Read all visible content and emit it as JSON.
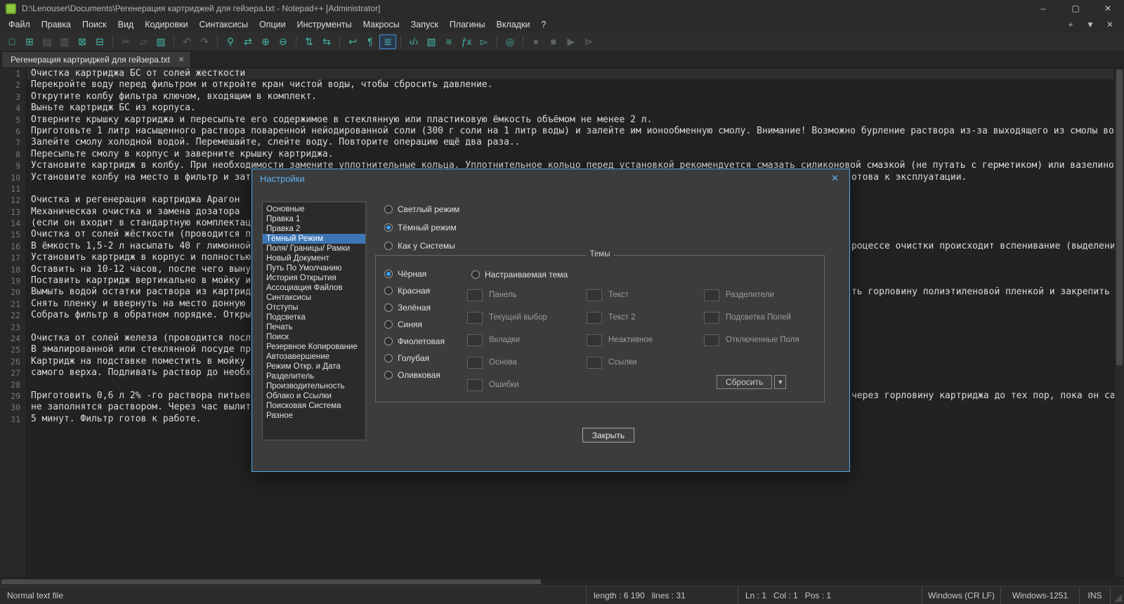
{
  "glyphs": {
    "close": "✕",
    "dropdown": "▼"
  },
  "colors": {
    "accent": "#51a7e8",
    "selection": "#3d76b5",
    "toolbar_icon": "#45b8a8",
    "radio_dot": "#35a2ff"
  },
  "window": {
    "title": "D:\\Lenouser\\Documents\\Регенерация картриджей для гейзера.txt - Notepad++ [Administrator]",
    "controls": [
      {
        "name": "minimize",
        "glyph": "–"
      },
      {
        "name": "maximize",
        "glyph": "▢"
      },
      {
        "name": "close",
        "glyph": "✕"
      }
    ]
  },
  "menubar": {
    "items": [
      "Файл",
      "Правка",
      "Поиск",
      "Вид",
      "Кодировки",
      "Синтаксисы",
      "Опции",
      "Инструменты",
      "Макросы",
      "Запуск",
      "Плагины",
      "Вкладки",
      "?"
    ],
    "extra_icons": [
      {
        "name": "new-tab",
        "glyph": "+"
      },
      {
        "name": "tab-list",
        "glyph": "▼"
      },
      {
        "name": "close-tab",
        "glyph": "✕"
      }
    ]
  },
  "toolbar": {
    "items": [
      {
        "name": "new-file",
        "glyph": "□"
      },
      {
        "name": "open-file",
        "glyph": "⊞"
      },
      {
        "name": "save-file",
        "glyph": "▤",
        "state": "disabled"
      },
      {
        "name": "save-all",
        "glyph": "▥",
        "state": "disabled"
      },
      {
        "name": "close-file",
        "glyph": "⊠"
      },
      {
        "name": "close-all",
        "glyph": "⊟"
      },
      {
        "sep": true
      },
      {
        "name": "cut",
        "glyph": "✂",
        "state": "disabled"
      },
      {
        "name": "copy",
        "glyph": "▱",
        "state": "disabled"
      },
      {
        "name": "paste",
        "glyph": "▨"
      },
      {
        "sep": true
      },
      {
        "name": "undo",
        "glyph": "↶",
        "state": "disabled"
      },
      {
        "name": "redo",
        "glyph": "↷",
        "state": "disabled"
      },
      {
        "sep": true
      },
      {
        "name": "find",
        "glyph": "⚲"
      },
      {
        "name": "replace",
        "glyph": "⇄"
      },
      {
        "name": "zoom-in",
        "glyph": "⊕"
      },
      {
        "name": "zoom-out",
        "glyph": "⊖"
      },
      {
        "sep": true
      },
      {
        "name": "sync-vertical",
        "glyph": "⇅"
      },
      {
        "name": "sync-horizontal",
        "glyph": "⇆"
      },
      {
        "sep": true
      },
      {
        "name": "word-wrap",
        "glyph": "↩"
      },
      {
        "name": "show-all-characters",
        "glyph": "¶"
      },
      {
        "name": "indent-guide",
        "glyph": "≣",
        "state": "active"
      },
      {
        "sep": true
      },
      {
        "name": "user-define-language",
        "glyph": "‹/›"
      },
      {
        "name": "document-map",
        "glyph": "▧"
      },
      {
        "name": "document-list",
        "glyph": "≡"
      },
      {
        "name": "function-list",
        "glyph": "ƒx"
      },
      {
        "name": "folder-as-workspace",
        "glyph": "▻"
      },
      {
        "sep": true
      },
      {
        "name": "monitoring",
        "glyph": "◎"
      },
      {
        "sep": true
      },
      {
        "name": "macro-record",
        "glyph": "●",
        "state": "disabled"
      },
      {
        "name": "macro-stop",
        "glyph": "■",
        "state": "disabled"
      },
      {
        "name": "macro-play",
        "glyph": "▶",
        "state": "disabled"
      },
      {
        "name": "macro-save",
        "glyph": "⊳",
        "state": "disabled"
      }
    ]
  },
  "tabbar": {
    "tabs": [
      {
        "label": "Регенерация картриджей для гейзера.txt",
        "active": true
      }
    ]
  },
  "editor": {
    "current_line": 1,
    "lines": [
      {
        "text": "Очистка картриджа БС от солей жесткости"
      },
      {
        "text": "Перекройте воду перед фильтром и откройте кран чистой воды, чтобы сбросить давление."
      },
      {
        "text": "Открутите колбу фильтра ключом, входящим в комплект."
      },
      {
        "text": "Выньте картридж БС из корпуса."
      },
      {
        "text": "Отверните крышку картриджа и пересыпьте его содержимое в стеклянную или пластиковую ёмкость объёмом не менее 2 л."
      },
      {
        "text": "Приготовьте 1 литр насыщенного раствора поваренной нейодированной соли (300 г соли на 1 литр воды) и залейте им ионообменную смолу. Внимание! Возможно бурление раствора из-за выходящего из смолы воздуха. Переме"
      },
      {
        "text": "Залейте смолу холодной водой. Перемешайте, слейте воду. Повторите операцию ещё два раза.."
      },
      {
        "text": "Пересыпьте смолу в корпус и заверните крышку картриджа."
      },
      {
        "text": "Установите картридж в колбу. При необходимости замените уплотнительные кольца. Уплотнительное кольцо перед установкой рекомендуется смазать силиконовой смазкой (не путать с герметиком) или вазелином."
      },
      {
        "text": "Установите колбу на место в фильтр и затян",
        "cont": "отова к эксплуатации.",
        "cont_col": 150
      },
      {
        "text": ""
      },
      {
        "text": "Очистка и регенерация картриджа Арагон"
      },
      {
        "text": "Механическая очистка и замена дозатора"
      },
      {
        "text": "(если он входит в стандартную комплектаци"
      },
      {
        "text": "Очистка от солей жёсткости (проводится пос"
      },
      {
        "text": "В ёмкость 1,5-2 л насыпать 40 г лимонной к",
        "cont": "роцессе очистки происходит вспенивание (выделение",
        "cont_col": 150
      },
      {
        "text": "Установить картридж в корпус и полностью з"
      },
      {
        "text": "Оставить на 10-12 часов, после чего вынуть"
      },
      {
        "text": "Поставить картридж вертикально в мойку и п"
      },
      {
        "text": "Вымыть водой остатки раствора из картриджа",
        "cont": "ть горловину полиэтиленовой пленкой и закрепить и",
        "cont_col": 150
      },
      {
        "text": "Снять пленку и ввернуть на место донную за"
      },
      {
        "text": "Собрать фильтр в обратном порядке. Откры"
      },
      {
        "text": ""
      },
      {
        "text": "Очистка от солей железа (проводится после"
      },
      {
        "text": "В эмалированной или стеклянной посуде при"
      },
      {
        "text": "Картридж на подставке поместить в мойку ил"
      },
      {
        "text": "самого верха. Подливать раствор до необх"
      },
      {
        "text": ""
      },
      {
        "text": "Приготовить 0,6 л 2% -го раствора питьевой",
        "cont": "через горловину картриджа до тех пор, пока он са",
        "cont_col": 150
      },
      {
        "text": "не заполнятся раствором. Через час вылить"
      },
      {
        "text": "5 минут. Фильтр готов к работе."
      }
    ]
  },
  "dialog": {
    "title": "Настройки",
    "categories": [
      "Основные",
      "Правка 1",
      "Правка 2",
      "Тёмный Режим",
      "Поля/ Границы/ Рамки",
      "Новый Документ",
      "Путь По Умолчанию",
      "История Открытия",
      "Ассоциация Файлов",
      "Синтаксисы",
      "Отступы",
      "Подсветка",
      "Печать",
      "Поиск",
      "Резервное Копирование",
      "Автозавершение",
      "Режим Откр. и Дата",
      "Разделитель",
      "Производительность",
      "Облако и Ссылки",
      "Поисковая Система",
      "Разное"
    ],
    "selected_category_index": 3,
    "mode_options": [
      {
        "label": "Светлый режим",
        "selected": false
      },
      {
        "label": "Тёмный режим",
        "selected": true
      },
      {
        "label": "Как у Системы",
        "selected": false
      }
    ],
    "themes_group_label": "Темы",
    "theme_options": [
      {
        "label": "Чёрная",
        "selected": true
      },
      {
        "label": "Красная",
        "selected": false
      },
      {
        "label": "Зелёная",
        "selected": false
      },
      {
        "label": "Синяя",
        "selected": false
      },
      {
        "label": "Фиолетовая",
        "selected": false
      },
      {
        "label": "Голубая",
        "selected": false
      },
      {
        "label": "Оливковая",
        "selected": false
      }
    ],
    "custom_theme": {
      "label": "Настраиваемая тема",
      "selected": false
    },
    "swatch_columns": [
      [
        "Панель",
        "Текущий выбор",
        "Вкладки",
        "Основа",
        "Ошибки"
      ],
      [
        "Текст",
        "Текст 2",
        "Неактивное",
        "Ссылки"
      ],
      [
        "Разделители",
        "Подсветка Полей",
        "Отключенные Поля"
      ]
    ],
    "buttons": {
      "reset": "Сбросить",
      "close": "Закрыть"
    }
  },
  "statusbar": {
    "doc_type": "Normal text file",
    "length_lines": "length : 6 190   lines : 31",
    "caret": "Ln : 1   Col : 1   Pos : 1",
    "eol": "Windows (CR LF)",
    "encoding": "Windows-1251",
    "insert_mode": "INS"
  }
}
